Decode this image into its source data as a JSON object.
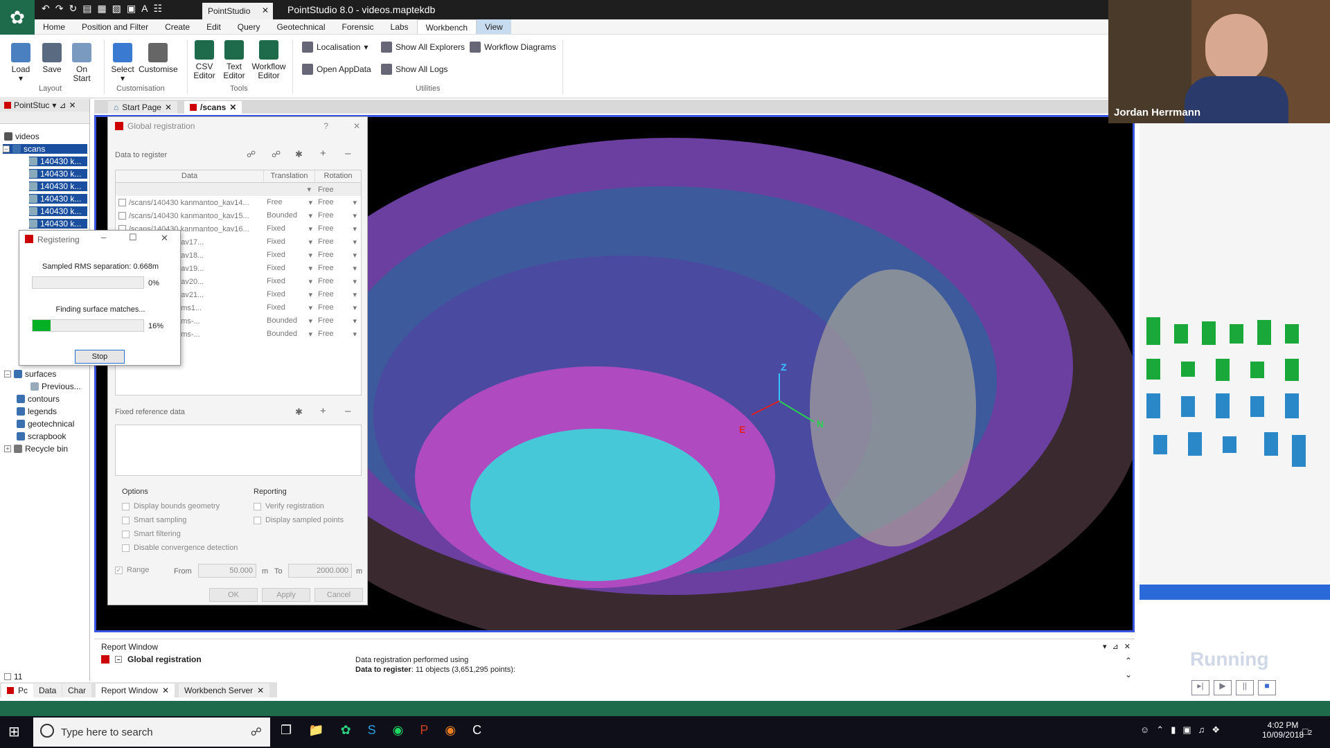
{
  "app": {
    "doc_tab": "PointStudio",
    "window_title": "PointStudio 8.0 - videos.maptekdb"
  },
  "menu": [
    "Home",
    "Position and Filter",
    "Create",
    "Edit",
    "Query",
    "Geotechnical",
    "Forensic",
    "Labs",
    "Workbench",
    "View"
  ],
  "ribbon": {
    "load": "Load",
    "save": "Save",
    "on_start_1": "On",
    "on_start_2": "Start",
    "layout_group": "Layout",
    "select": "Select",
    "customise": "Customise",
    "customisation_group": "Customisation",
    "csv_1": "CSV",
    "csv_2": "Editor",
    "text_1": "Text",
    "text_2": "Editor",
    "workflow_1": "Workflow",
    "workflow_2": "Editor",
    "tools_group": "Tools",
    "localisation": "Localisation",
    "show_all_explorers": "Show All Explorers",
    "workflow_diagrams": "Workflow Diagrams",
    "open_appdata": "Open AppData",
    "show_all_logs": "Show All Logs",
    "utilities_group": "Utilities"
  },
  "left_panel": {
    "title": "PointStuc",
    "tree": {
      "root": "videos",
      "scans": "scans",
      "scan_items": [
        "140430 k...",
        "140430 k...",
        "140430 k...",
        "140430 k...",
        "140430 k...",
        "140430 k..."
      ],
      "surfaces": "surfaces",
      "previous": "Previous...",
      "contours": "contours",
      "legends": "legends",
      "geotechnical": "geotechnical",
      "scrapbook": "scrapbook",
      "recycle_bin": "Recycle bin"
    },
    "count": "11"
  },
  "doc_tabs": {
    "start_page": "Start Page",
    "scans": "/scans"
  },
  "viewport": {
    "axis_z": "Z",
    "axis_n": "N",
    "axis_e": "E"
  },
  "global_registration": {
    "title": "Global registration",
    "data_to_register": "Data to register",
    "columns": [
      "Data",
      "Translation",
      "Rotation"
    ],
    "header_default_rotation": "Free",
    "rows": [
      {
        "data": "/scans/140430 kanmantoo_kav14...",
        "translation": "Free",
        "rotation": "Free"
      },
      {
        "data": "/scans/140430 kanmantoo_kav15...",
        "translation": "Bounded",
        "rotation": "Free"
      },
      {
        "data": "/scans/140430 kanmantoo_kav16...",
        "translation": "Fixed",
        "rotation": "Free"
      },
      {
        "data": "0 kanmantoo_kav17...",
        "translation": "Fixed",
        "rotation": "Free"
      },
      {
        "data": "0 kanmantoo_kav18...",
        "translation": "Fixed",
        "rotation": "Free"
      },
      {
        "data": "0 kanmantoo_kav19...",
        "translation": "Fixed",
        "rotation": "Free"
      },
      {
        "data": "0 kanmantoo_kav20...",
        "translation": "Fixed",
        "rotation": "Free"
      },
      {
        "data": "0 kanmantoo_kav21...",
        "translation": "Fixed",
        "rotation": "Free"
      },
      {
        "data": "0 kanmantoo_kms1...",
        "translation": "Fixed",
        "rotation": "Free"
      },
      {
        "data": "0 kanmantoo_kms-...",
        "translation": "Bounded",
        "rotation": "Free"
      },
      {
        "data": "0 kanmantoo_kms-...",
        "translation": "Bounded",
        "rotation": "Free"
      }
    ],
    "fixed_reference": "Fixed reference data",
    "options": "Options",
    "reporting": "Reporting",
    "opt_display_bounds": "Display bounds geometry",
    "opt_smart_sampling": "Smart sampling",
    "opt_smart_filtering": "Smart filtering",
    "opt_disable_convergence": "Disable convergence detection",
    "rep_verify": "Verify registration",
    "rep_display_sampled": "Display sampled points",
    "range": "Range",
    "from": "From",
    "from_value": "50.000",
    "m1": "m",
    "to": "To",
    "to_value": "2000.000",
    "m2": "m",
    "ok": "OK",
    "apply": "Apply",
    "cancel": "Cancel"
  },
  "registering": {
    "title": "Registering",
    "rms_label": "Sampled RMS separation: 0.668m",
    "progress1_text": "0%",
    "progress1": 0,
    "finding_label": "Finding surface matches...",
    "progress2_text": "16%",
    "progress2": 0.16,
    "stop": "Stop"
  },
  "report": {
    "title": "Report Window",
    "item": "Global registration",
    "line1": "Data registration performed using",
    "line2_bold": "Data to register",
    "line2_rest": ": 11 objects (3,651,295 points):"
  },
  "bottom_tabs": {
    "pc": "Pc",
    "data": "Data",
    "char": "Char",
    "report": "Report Window",
    "workbench": "Workbench Server"
  },
  "webcam": {
    "name": "Jordan Herrmann"
  },
  "right_panel": {
    "running": "Running"
  },
  "taskbar": {
    "search_placeholder": "Type here to search",
    "time": "4:02 PM",
    "date": "10/09/2018",
    "notifications": "2"
  },
  "colors": {
    "accent_green": "#1d6b4b",
    "viewport_border": "#3a56e0",
    "progress_green": "#06b025"
  }
}
